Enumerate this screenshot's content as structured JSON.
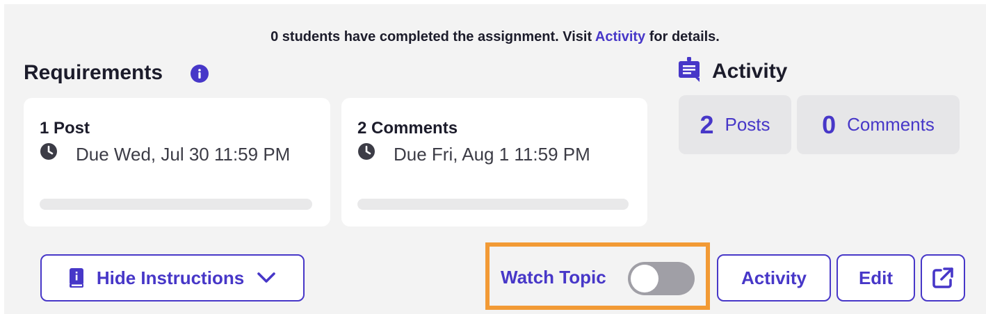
{
  "notice": {
    "before": "0 students have completed the assignment. Visit ",
    "link": "Activity",
    "after": " for details."
  },
  "requirements": {
    "title": "Requirements",
    "info_icon": "info-icon",
    "cards": [
      {
        "title": "1 Post",
        "due": "Due Wed, Jul 30 11:59 PM",
        "icon": "clock-icon",
        "progress": 0
      },
      {
        "title": "2 Comments",
        "due": "Due Fri, Aug 1 11:59 PM",
        "icon": "clock-icon",
        "progress": 0
      }
    ]
  },
  "activity": {
    "title": "Activity",
    "icon": "activity-board-icon",
    "stats": [
      {
        "value": "2",
        "label": "Posts"
      },
      {
        "value": "0",
        "label": "Comments"
      }
    ]
  },
  "toolbar": {
    "hide_instructions": "Hide Instructions",
    "watch_topic": "Watch Topic",
    "watch_topic_on": false,
    "activity_button": "Activity",
    "edit_button": "Edit",
    "external_icon": "external-link-icon"
  },
  "colors": {
    "accent": "#4737c8",
    "highlight": "#f29a35",
    "background": "#f3f3f3"
  }
}
